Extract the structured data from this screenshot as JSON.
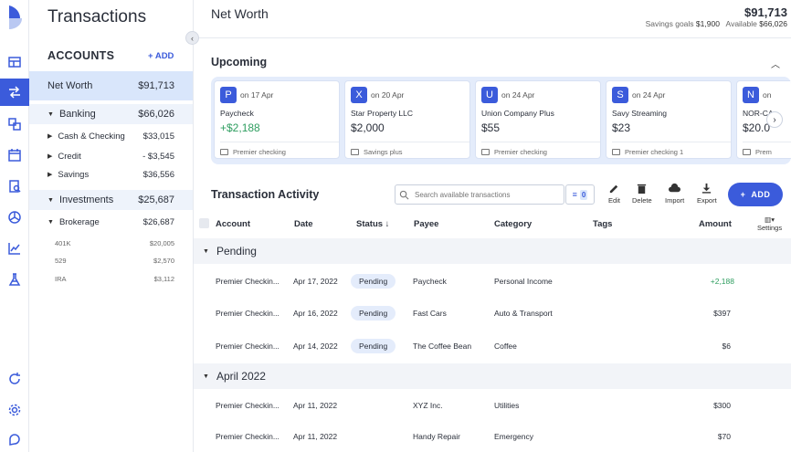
{
  "nav": {
    "icons": [
      "logo",
      "dashboard-icon",
      "transactions-icon",
      "accounts-icon",
      "calendar-icon",
      "reports-icon",
      "budget-pie-icon",
      "investments-chart-icon",
      "forecast-icon",
      "refresh-icon",
      "settings-gear-icon",
      "help-icon"
    ]
  },
  "sidebar": {
    "title": "Transactions",
    "accounts_heading": "ACCOUNTS",
    "add_label": "+ ADD",
    "net_worth": {
      "label": "Net Worth",
      "value": "$91,713"
    },
    "groups": [
      {
        "label": "Banking",
        "value": "$66,026",
        "items": [
          {
            "label": "Cash & Checking",
            "value": "$33,015"
          },
          {
            "label": "Credit",
            "value": "- $3,545"
          },
          {
            "label": "Savings",
            "value": "$36,556"
          }
        ]
      },
      {
        "label": "Investments",
        "value": "$25,687",
        "items": [
          {
            "label": "Brokerage",
            "value": "$26,687"
          }
        ],
        "subitems": [
          {
            "label": "401K",
            "value": "$20,005"
          },
          {
            "label": "529",
            "value": "$2,570"
          },
          {
            "label": "IRA",
            "value": "$3,112"
          }
        ]
      }
    ]
  },
  "header": {
    "title": "Net Worth",
    "amount": "$91,713",
    "savings_label": "Savings goals",
    "savings_value": "$1,900",
    "available_label": "Available",
    "available_value": "$66,026"
  },
  "upcoming": {
    "title": "Upcoming",
    "cards": [
      {
        "letter": "P",
        "date": "on 17 Apr",
        "name": "Paycheck",
        "amount": "+$2,188",
        "positive": true,
        "account": "Premier checking"
      },
      {
        "letter": "X",
        "date": "on 20 Apr",
        "name": "Star Property LLC",
        "amount": "$2,000",
        "positive": false,
        "account": "Savings plus"
      },
      {
        "letter": "U",
        "date": "on 24 Apr",
        "name": "Union Company Plus",
        "amount": "$55",
        "positive": false,
        "account": "Premier checking"
      },
      {
        "letter": "S",
        "date": "on 24 Apr",
        "name": "Savy Streaming",
        "amount": "$23",
        "positive": false,
        "account": "Premier checking 1"
      },
      {
        "letter": "N",
        "date": "on",
        "name": "NOR-CA",
        "amount": "$20.0",
        "positive": false,
        "account": "Prem"
      }
    ]
  },
  "activity": {
    "title": "Transaction Activity",
    "search_placeholder": "Search available transactions",
    "filter_count": "0",
    "tools": {
      "edit": "Edit",
      "delete": "Delete",
      "import": "Import",
      "export": "Export"
    },
    "add_label": "ADD",
    "columns": {
      "account": "Account",
      "date": "Date",
      "status": "Status ↓",
      "payee": "Payee",
      "category": "Category",
      "tags": "Tags",
      "amount": "Amount",
      "settings": "Settings"
    },
    "sections": [
      {
        "label": "Pending",
        "rows": [
          {
            "account": "Premier Checkin...",
            "date": "Apr 17, 2022",
            "status": "Pending",
            "payee": "Paycheck",
            "category": "Personal Income",
            "amount": "+2,188"
          },
          {
            "account": "Premier Checkin...",
            "date": "Apr 16, 2022",
            "status": "Pending",
            "payee": "Fast Cars",
            "category": "Auto & Transport",
            "amount": "$397"
          },
          {
            "account": "Premier Checkin...",
            "date": "Apr 14, 2022",
            "status": "Pending",
            "payee": "The Coffee Bean",
            "category": "Coffee",
            "amount": "$6"
          }
        ]
      },
      {
        "label": "April 2022",
        "rows": [
          {
            "account": "Premier Checkin...",
            "date": "Apr 11, 2022",
            "status": "",
            "payee": "XYZ Inc.",
            "category": "Utilities",
            "amount": "$300"
          },
          {
            "account": "Premier Checkin...",
            "date": "Apr 11, 2022",
            "status": "",
            "payee": "Handy Repair",
            "category": "Emergency",
            "amount": "$70"
          }
        ]
      }
    ]
  },
  "colors": {
    "accent": "#3b5bdb",
    "selected_bg": "#d9e6fb",
    "positive": "#2f9e60"
  }
}
